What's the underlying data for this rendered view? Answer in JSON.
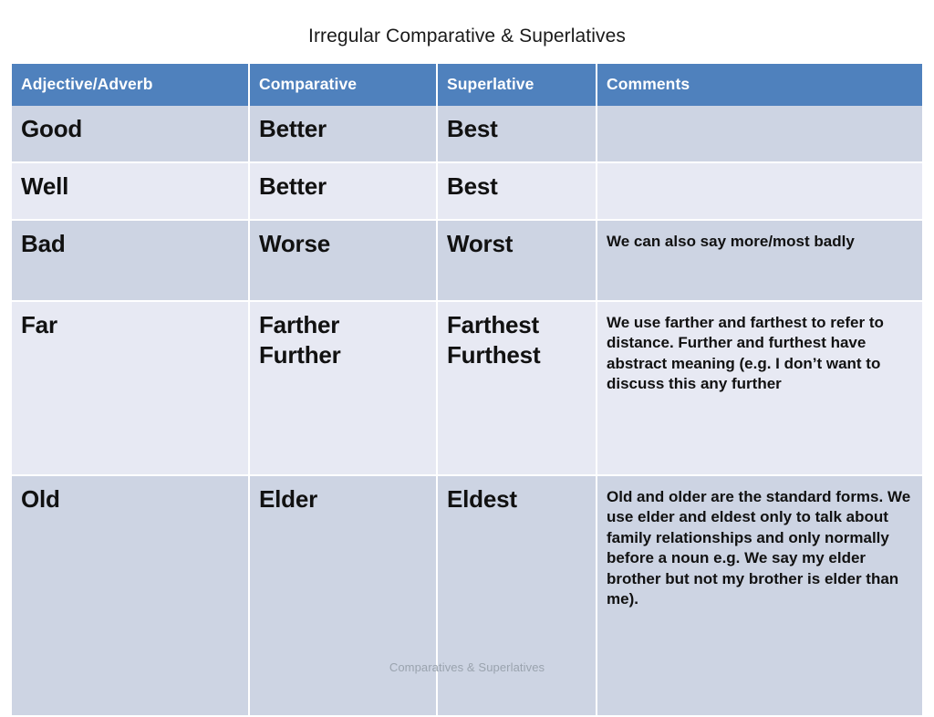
{
  "slide": {
    "title": "Irregular Comparative & Superlatives",
    "footer": "Comparatives & Superlatives"
  },
  "colors": {
    "header_blue": "#4F81BD",
    "row_shade": "#CDD4E3",
    "row_light": "#E7E9F3",
    "text": "#111111",
    "footer_text": "#9AA3AE",
    "page_background": "#FFFFFF"
  },
  "table": {
    "headers": {
      "adjective": "Adjective/Adverb",
      "comparative": "Comparative",
      "superlative": "Superlative",
      "comments": "Comments"
    },
    "rows": [
      {
        "adjective": "Good",
        "comparative": "Better",
        "superlative": "Best",
        "comments": ""
      },
      {
        "adjective": "Well",
        "comparative": "Better",
        "superlative": "Best",
        "comments": ""
      },
      {
        "adjective": "Bad",
        "comparative": "Worse",
        "superlative": "Worst",
        "comments": "We can also say more/most badly"
      },
      {
        "adjective": "Far",
        "comparative_line1": "Farther",
        "comparative_line2": "Further",
        "superlative_line1": "Farthest",
        "superlative_line2": "Furthest",
        "comments": "We use farther and farthest  to refer to distance. Further and furthest have abstract meaning (e.g. I don’t want to discuss this any further"
      },
      {
        "adjective": "Old",
        "comparative": "Elder",
        "superlative": "Eldest",
        "comments": "Old and older are the standard forms. We use elder and eldest only to talk about family relationships and only normally before a noun e.g. We say my elder brother but not my brother is elder than me)."
      }
    ]
  }
}
